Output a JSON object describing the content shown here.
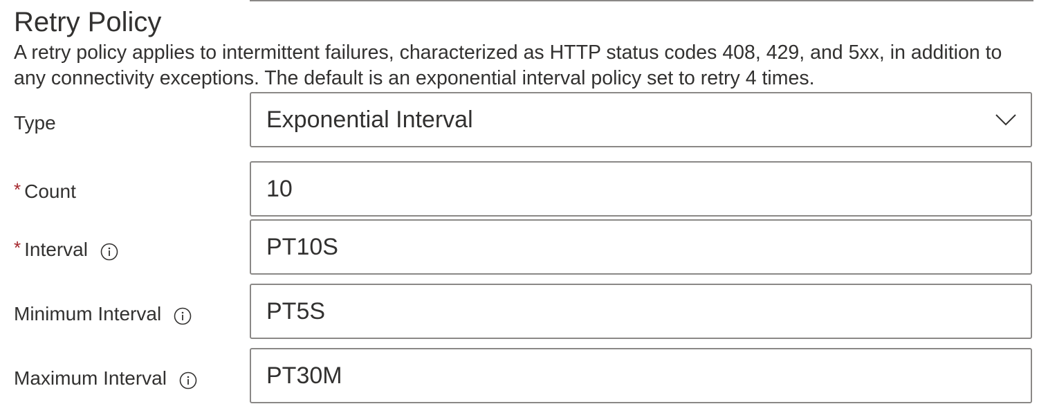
{
  "section": {
    "title": "Retry Policy",
    "description": "A retry policy applies to intermittent failures, characterized as HTTP status codes 408, 429, and 5xx, in addition to any connectivity exceptions. The default is an exponential interval policy set to retry 4 times."
  },
  "fields": {
    "type": {
      "label": "Type",
      "value": "Exponential Interval",
      "icon": "chevron-down-icon"
    },
    "count": {
      "required_mark": "*",
      "label": "Count",
      "value": "10"
    },
    "interval": {
      "required_mark": "*",
      "label": "Interval",
      "value": "PT10S",
      "icon": "info-icon"
    },
    "minimum_interval": {
      "label": "Minimum Interval",
      "value": "PT5S",
      "icon": "info-icon"
    },
    "maximum_interval": {
      "label": "Maximum Interval",
      "value": "PT30M",
      "icon": "info-icon"
    }
  },
  "colors": {
    "text": "#323130",
    "required": "#a4262c",
    "border": "#8a8886"
  }
}
